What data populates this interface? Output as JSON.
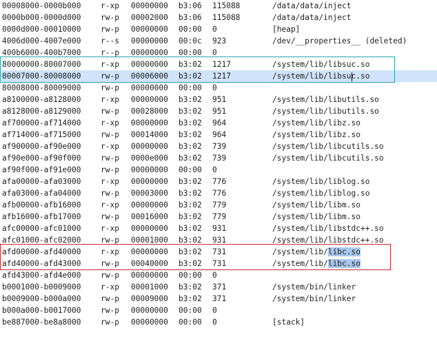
{
  "rows": [
    {
      "addr": "00008000-0000b000",
      "perm": "r-xp",
      "offset": "00000000",
      "dev": "b3:06",
      "inode": "115088",
      "path": "/data/data/inject"
    },
    {
      "addr": "0000b000-0000d000",
      "perm": "rw-p",
      "offset": "00002000",
      "dev": "b3:06",
      "inode": "115088",
      "path": "/data/data/inject"
    },
    {
      "addr": "0000d000-00010000",
      "perm": "rw-p",
      "offset": "00000000",
      "dev": "00:00",
      "inode": "0",
      "path": "[heap]"
    },
    {
      "addr": "4006d000-4007e000",
      "perm": "r--s",
      "offset": "00000000",
      "dev": "00:0c",
      "inode": "923",
      "path": "/dev/__properties__ (deleted)"
    },
    {
      "addr": "400b6000-400b7000",
      "perm": "r--p",
      "offset": "00000000",
      "dev": "00:00",
      "inode": "0",
      "path": ""
    },
    {
      "addr": "80000000-80007000",
      "perm": "r-xp",
      "offset": "00000000",
      "dev": "b3:02",
      "inode": "1217",
      "path": "/system/lib/libsuc.so"
    },
    {
      "addr": "80007000-80008000",
      "perm": "rw-p",
      "offset": "00006000",
      "dev": "b3:02",
      "inode": "1217",
      "path": "/system/lib/libsuc.so"
    },
    {
      "addr": "80008000-80009000",
      "perm": "rw-p",
      "offset": "00000000",
      "dev": "00:00",
      "inode": "0",
      "path": ""
    },
    {
      "addr": "a8100000-a8128000",
      "perm": "r-xp",
      "offset": "00000000",
      "dev": "b3:02",
      "inode": "951",
      "path": "/system/lib/libutils.so"
    },
    {
      "addr": "a8128000-a8129000",
      "perm": "rw-p",
      "offset": "00028000",
      "dev": "b3:02",
      "inode": "951",
      "path": "/system/lib/libutils.so"
    },
    {
      "addr": "af700000-af714000",
      "perm": "r-xp",
      "offset": "00000000",
      "dev": "b3:02",
      "inode": "964",
      "path": "/system/lib/libz.so"
    },
    {
      "addr": "af714000-af715000",
      "perm": "rw-p",
      "offset": "00014000",
      "dev": "b3:02",
      "inode": "964",
      "path": "/system/lib/libz.so"
    },
    {
      "addr": "af900000-af90e000",
      "perm": "r-xp",
      "offset": "00000000",
      "dev": "b3:02",
      "inode": "739",
      "path": "/system/lib/libcutils.so"
    },
    {
      "addr": "af90e000-af90f000",
      "perm": "rw-p",
      "offset": "0000e000",
      "dev": "b3:02",
      "inode": "739",
      "path": "/system/lib/libcutils.so"
    },
    {
      "addr": "af90f000-af91e000",
      "perm": "rw-p",
      "offset": "00000000",
      "dev": "00:00",
      "inode": "0",
      "path": ""
    },
    {
      "addr": "afa00000-afa03000",
      "perm": "r-xp",
      "offset": "00000000",
      "dev": "b3:02",
      "inode": "776",
      "path": "/system/lib/liblog.so"
    },
    {
      "addr": "afa03000-afa04000",
      "perm": "rw-p",
      "offset": "00003000",
      "dev": "b3:02",
      "inode": "776",
      "path": "/system/lib/liblog.so"
    },
    {
      "addr": "afb00000-afb16000",
      "perm": "r-xp",
      "offset": "00000000",
      "dev": "b3:02",
      "inode": "779",
      "path": "/system/lib/libm.so"
    },
    {
      "addr": "afb16000-afb17000",
      "perm": "rw-p",
      "offset": "00016000",
      "dev": "b3:02",
      "inode": "779",
      "path": "/system/lib/libm.so"
    },
    {
      "addr": "afc00000-afc01000",
      "perm": "r-xp",
      "offset": "00000000",
      "dev": "b3:02",
      "inode": "931",
      "path": "/system/lib/libstdc++.so"
    },
    {
      "addr": "afc01000-afc02000",
      "perm": "rw-p",
      "offset": "00001000",
      "dev": "b3:02",
      "inode": "931",
      "path": "/system/lib/libstdc++.so"
    },
    {
      "addr": "afd00000-afd40000",
      "perm": "r-xp",
      "offset": "00000000",
      "dev": "b3:02",
      "inode": "731",
      "path": "/system/lib/libc.so"
    },
    {
      "addr": "afd40000-afd43000",
      "perm": "rw-p",
      "offset": "00040000",
      "dev": "b3:02",
      "inode": "731",
      "path": "/system/lib/libc.so"
    },
    {
      "addr": "afd43000-afd4e000",
      "perm": "rw-p",
      "offset": "00000000",
      "dev": "00:00",
      "inode": "0",
      "path": ""
    },
    {
      "addr": "b0001000-b0009000",
      "perm": "r-xp",
      "offset": "00001000",
      "dev": "b3:02",
      "inode": "371",
      "path": "/system/bin/linker"
    },
    {
      "addr": "b0009000-b000a000",
      "perm": "rw-p",
      "offset": "00009000",
      "dev": "b3:02",
      "inode": "371",
      "path": "/system/bin/linker"
    },
    {
      "addr": "b000a000-b0017000",
      "perm": "rw-p",
      "offset": "00000000",
      "dev": "00:00",
      "inode": "0",
      "path": ""
    },
    {
      "addr": "be887000-be8a8000",
      "perm": "rw-p",
      "offset": "00000000",
      "dev": "00:00",
      "inode": "0",
      "path": "[stack]"
    }
  ],
  "selected_line": 6,
  "libc_rows": [
    21,
    22
  ],
  "highlight_text": "libc.so",
  "colors": {
    "teal_box": "#2aa0a8",
    "red_box": "#c0282d",
    "line_selection": "#cfe3fa",
    "word_highlight": "#a7c7ed"
  }
}
